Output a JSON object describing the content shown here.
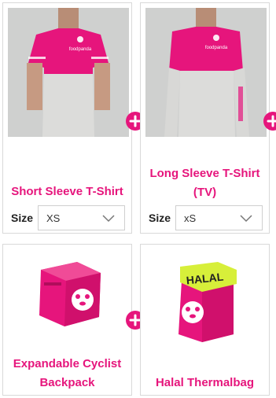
{
  "products": [
    {
      "title": "Short Sleeve T-Shirt",
      "size_label": "Size",
      "size_value": "XS"
    },
    {
      "title": "Long Sleeve T-Shirt (TV)",
      "size_label": "Size",
      "size_value": "xS"
    },
    {
      "title": "Expandable Cyclist Backpack"
    },
    {
      "title": "Halal Thermalbag",
      "bag_text": "HALAL"
    }
  ],
  "brand_text": "foodpanda",
  "colors": {
    "accent": "#e6157c",
    "border": "#d9d9d9",
    "tshirt_body": "#d8d8d6"
  }
}
